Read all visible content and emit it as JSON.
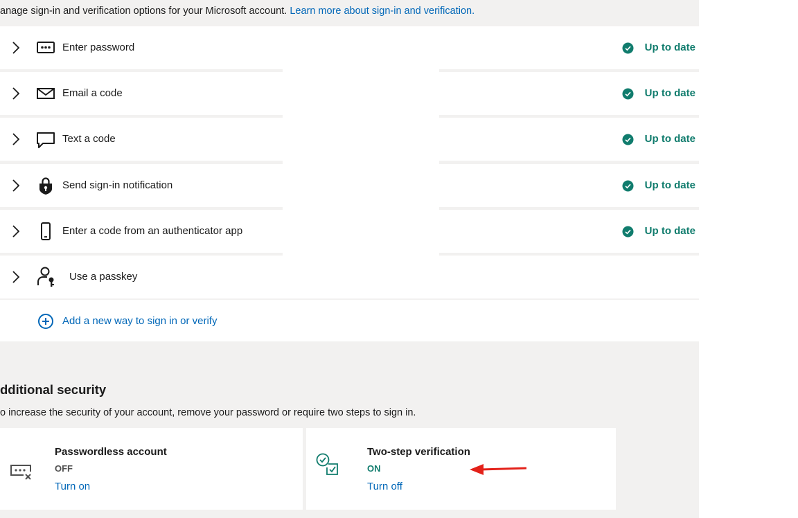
{
  "intro": {
    "text": "anage sign-in and verification options for your Microsoft account.",
    "link": "Learn more about sign-in and verification."
  },
  "methods": [
    {
      "label": "Enter password",
      "status": "Up to date",
      "icon": "password-dots-icon"
    },
    {
      "label": "Email a code",
      "status": "Up to date",
      "icon": "envelope-icon"
    },
    {
      "label": "Text a code",
      "status": "Up to date",
      "icon": "chat-bubble-icon"
    },
    {
      "label": "Send sign-in notification",
      "status": "Up to date",
      "icon": "lock-shield-icon"
    },
    {
      "label": "Enter a code from an authenticator app",
      "status": "Up to date",
      "icon": "phone-icon"
    },
    {
      "label": "Use a passkey",
      "status": "",
      "icon": "person-key-icon"
    }
  ],
  "add_method": {
    "label": "Add a new way to sign in or verify",
    "icon": "add-circle-icon"
  },
  "additional_security": {
    "title": "dditional security",
    "description": "o increase the security of your account, remove your password or require two steps to sign in.",
    "cards": [
      {
        "title": "Passwordless account",
        "state": "OFF",
        "action": "Turn on",
        "icon": "password-off-icon"
      },
      {
        "title": "Two-step verification",
        "state": "ON",
        "action": "Turn off",
        "icon": "two-step-check-icon"
      }
    ]
  },
  "colors": {
    "accent_link": "#0067b8",
    "status_green": "#107c6d",
    "annotation_red": "#e32119",
    "page_background": "#f2f1f0"
  }
}
